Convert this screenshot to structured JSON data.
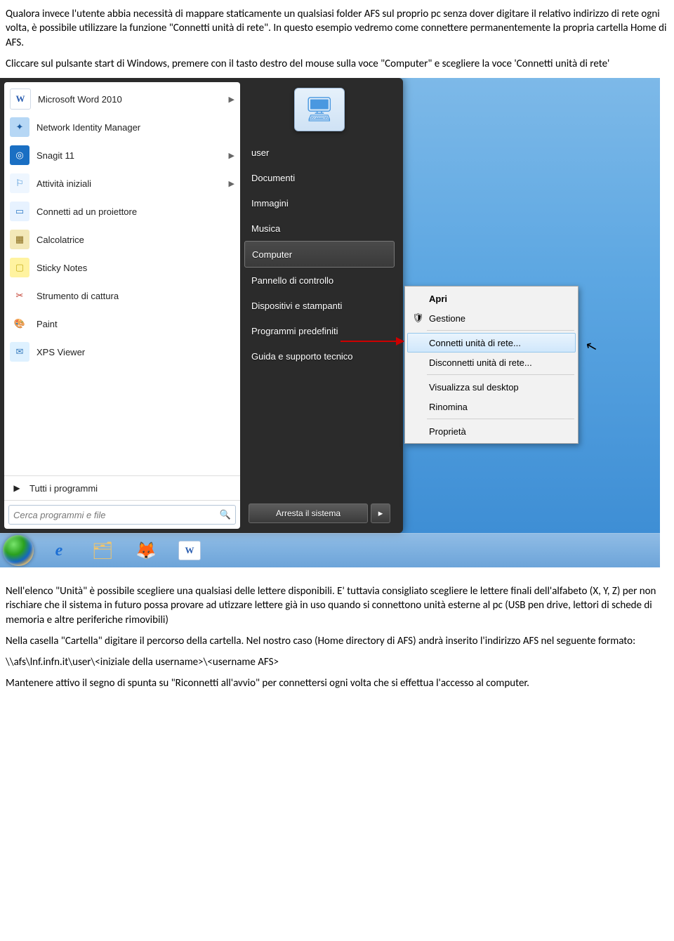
{
  "doc": {
    "p1": "Qualora invece l'utente abbia necessità di mappare staticamente un qualsiasi folder AFS sul proprio pc senza dover digitare il relativo indirizzo di rete ogni volta, è possibile utilizzare la funzione \"Connetti unità di rete\". In questo esempio vedremo come connettere permanentemente la propria cartella Home di AFS.",
    "p2": "Cliccare sul pulsante start di Windows, premere con il tasto destro del mouse sulla voce \"Computer\" e scegliere la voce 'Connetti unità di rete'",
    "p3": "Nell'elenco \"Unità\" è possibile scegliere una qualsiasi delle lettere disponibili. E' tuttavia consigliato scegliere le lettere finali dell'alfabeto (X, Y, Z) per non rischiare che il sistema in futuro possa provare ad utizzare lettere già in uso quando si connettono unità esterne al pc (USB pen drive, lettori di schede di memoria e altre periferiche rimovibili)",
    "p4": "Nella casella \"Cartella\" digitare il percorso della cartella. Nel nostro caso (Home directory di AFS) andrà inserito l'indirizzo AFS nel seguente formato:",
    "p5": "\\\\afs\\lnf.infn.it\\user\\<iniziale della username>\\<username AFS>",
    "p6": "Mantenere attivo il segno di spunta su \"Riconnetti all'avvio\" per connettersi ogni volta che si effettua l'accesso al computer."
  },
  "startmenu": {
    "programs": [
      {
        "label": "Microsoft Word 2010",
        "sub": true
      },
      {
        "label": "Network Identity Manager",
        "sub": false
      },
      {
        "label": "Snagit 11",
        "sub": true
      },
      {
        "label": "Attività iniziali",
        "sub": true
      },
      {
        "label": "Connetti ad un proiettore",
        "sub": false
      },
      {
        "label": "Calcolatrice",
        "sub": false
      },
      {
        "label": "Sticky Notes",
        "sub": false
      },
      {
        "label": "Strumento di cattura",
        "sub": false
      },
      {
        "label": "Paint",
        "sub": false
      },
      {
        "label": "XPS Viewer",
        "sub": false
      }
    ],
    "all_programs": "Tutti i programmi",
    "search_placeholder": "Cerca programmi e file",
    "right": {
      "user": "user",
      "links": [
        "Documenti",
        "Immagini",
        "Musica",
        "Computer",
        "Pannello di controllo",
        "Dispositivi e stampanti",
        "Programmi predefiniti",
        "Guida e supporto tecnico"
      ],
      "shutdown": "Arresta il sistema"
    }
  },
  "context": {
    "open": "Apri",
    "manage": "Gestione",
    "map": "Connetti unità di rete...",
    "unmap": "Disconnetti unità di rete...",
    "showdesktop": "Visualizza sul desktop",
    "rename": "Rinomina",
    "properties": "Proprietà"
  },
  "icons": {
    "word": "W",
    "nim": "✦",
    "snagit": "◎",
    "getstarted": "⚐",
    "projector": "▭",
    "calc": "▦",
    "sticky": "▢",
    "snip": "✂",
    "paint": "🎨",
    "xps": "✉",
    "shield": "🛡",
    "monitor": "🖥",
    "ie": "e",
    "folder": "🗂",
    "firefox": "🦊"
  }
}
